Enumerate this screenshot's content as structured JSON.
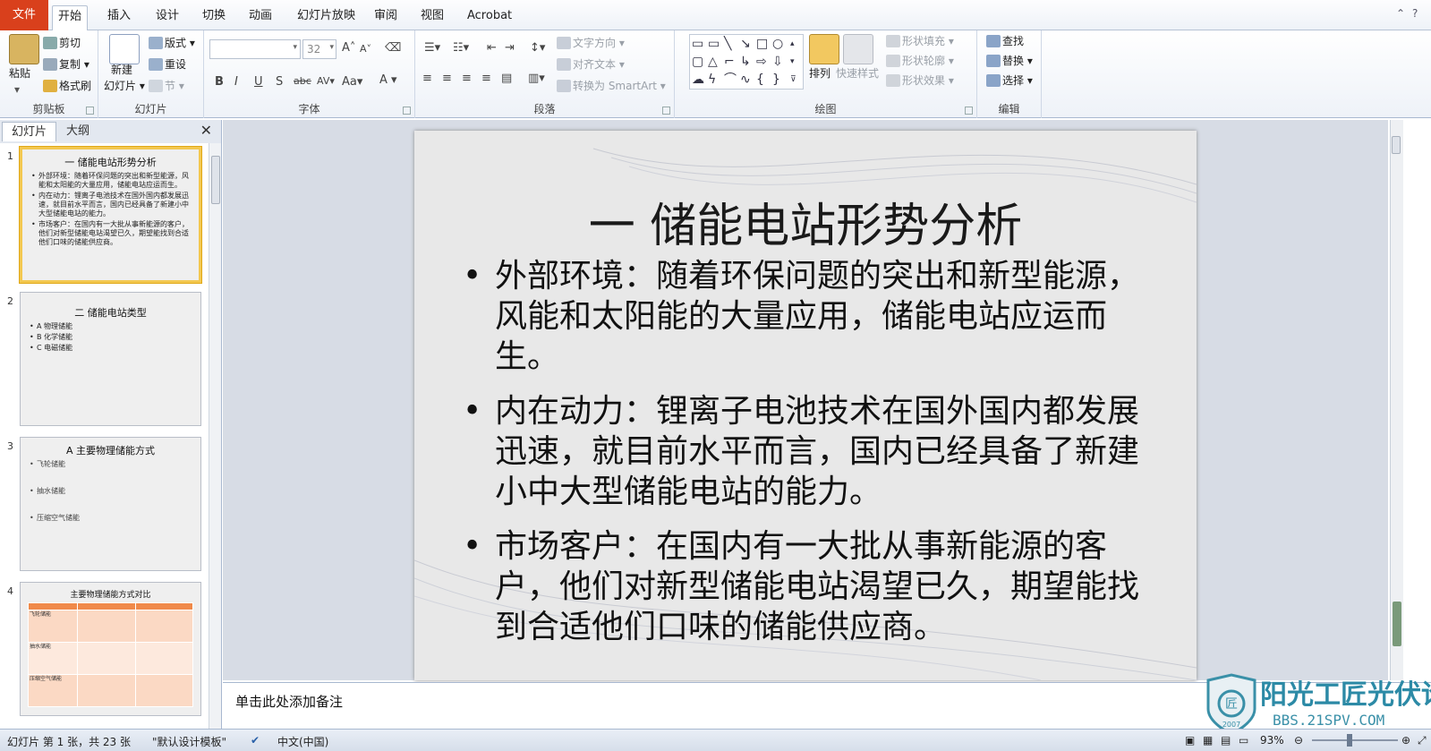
{
  "tabs": {
    "file": "文件",
    "items": [
      "开始",
      "插入",
      "设计",
      "切换",
      "动画",
      "幻灯片放映",
      "审阅",
      "视图",
      "Acrobat"
    ]
  },
  "ribbon": {
    "clipboard": {
      "paste": "粘贴",
      "cut": "剪切",
      "copy": "复制",
      "format_painter": "格式刷",
      "label": "剪贴板"
    },
    "slides": {
      "new_slide": "新建",
      "new_slide2": "幻灯片",
      "layout": "版式",
      "reset": "重设",
      "section": "节",
      "label": "幻灯片"
    },
    "font": {
      "size": "32",
      "bold": "B",
      "italic": "I",
      "underline": "U",
      "shadow": "S",
      "strike": "abc",
      "spacing": "AV",
      "case": "Aa",
      "color": "A",
      "grow": "A",
      "shrink": "A",
      "label": "字体"
    },
    "paragraph": {
      "text_direction": "文字方向",
      "align_text": "对齐文本",
      "smartart": "转换为 SmartArt",
      "label": "段落"
    },
    "drawing": {
      "arrange": "排列",
      "quick_styles": "快速样式",
      "shape_fill": "形状填充",
      "shape_outline": "形状轮廓",
      "shape_effects": "形状效果",
      "label": "绘图"
    },
    "editing": {
      "find": "查找",
      "replace": "替换",
      "select": "选择",
      "label": "编辑"
    }
  },
  "left_panel": {
    "tabs": [
      "幻灯片",
      "大纲"
    ],
    "thumbs": [
      {
        "num": "1",
        "title": "一 储能电站形势分析",
        "bullets": [
          "外部环境：随着环保问题的突出和新型能源，风能和太阳能的大量应用，储能电站应运而生。",
          "内在动力：锂离子电池技术在国外国内都发展迅速，就目前水平而言，国内已经具备了新建小中大型储能电站的能力。",
          "市场客户：在国内有一大批从事新能源的客户，他们对新型储能电站渴望已久，期望能找到合适他们口味的储能供应商。"
        ]
      },
      {
        "num": "2",
        "title": "二 储能电站类型",
        "bullets": [
          "A 物理储能",
          "B 化学储能",
          "C 电磁储能"
        ]
      },
      {
        "num": "3",
        "title": "A 主要物理储能方式",
        "bullets": [
          "飞轮储能",
          "抽水储能",
          "压缩空气储能"
        ]
      },
      {
        "num": "4",
        "title": "主要物理储能方式对比",
        "rows": [
          "飞轮储能",
          "抽水储能",
          "压缩空气储能"
        ]
      }
    ]
  },
  "slide": {
    "title": "一 储能电站形势分析",
    "bullets": [
      "外部环境：随着环保问题的突出和新型能源，风能和太阳能的大量应用，储能电站应运而生。",
      "内在动力：锂离子电池技术在国外国内都发展迅速，就目前水平而言，国内已经具备了新建小中大型储能电站的能力。",
      "市场客户：在国内有一大批从事新能源的客户，他们对新型储能电站渴望已久，期望能找到合适他们口味的储能供应商。"
    ]
  },
  "notes_placeholder": "单击此处添加备注",
  "status": {
    "slide_info": "幻灯片 第 1 张，共 23 张",
    "theme": "\"默认设计模板\"",
    "language": "中文(中国)",
    "zoom": "93%"
  },
  "logo": {
    "name": "阳光工匠光伏论坛",
    "url": "BBS.21SPV.COM",
    "year": "2007"
  },
  "colors": {
    "file_tab": "#d9401c",
    "accent": "#f3c850"
  }
}
